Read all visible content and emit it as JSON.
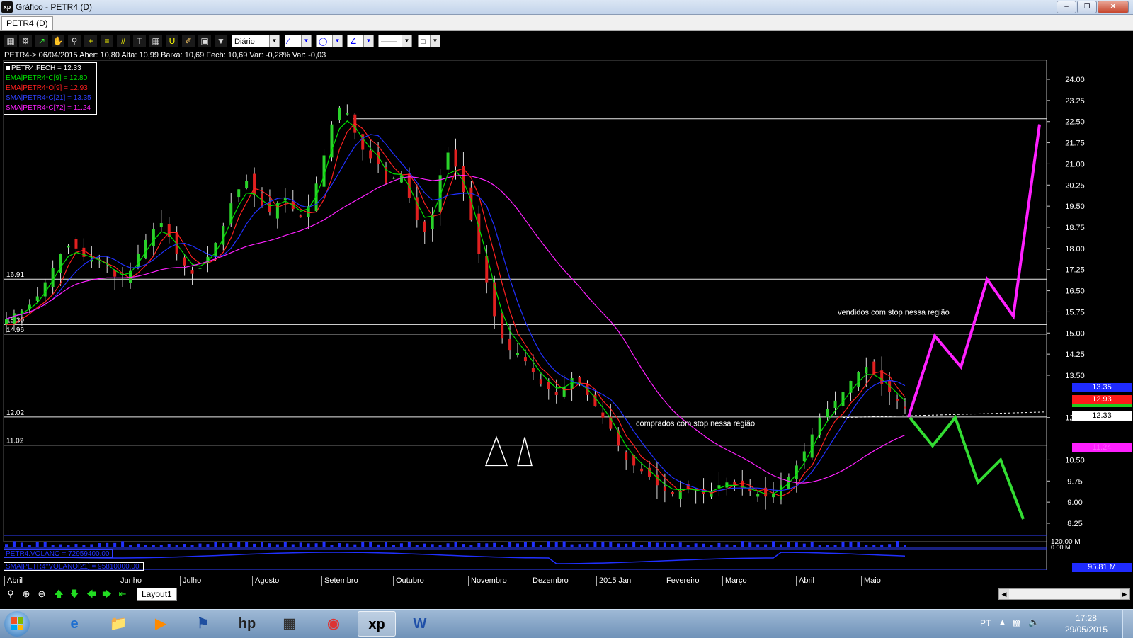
{
  "window": {
    "title": "Gráfico - PETR4 (D)",
    "app_icon": "xp"
  },
  "tabs": [
    {
      "label": "PETR4 (D)"
    }
  ],
  "toolbar": {
    "period_select": "Diário"
  },
  "info_line": "PETR4-> 06/04/2015 Aber: 10,80 Alta: 10,99 Baixa: 10,69 Fech: 10,69 Var: -0,28% Var: -0,03",
  "legend": [
    {
      "label": "PETR4.FECH = 12.33",
      "color": "#ffffff"
    },
    {
      "label": "EMA|PETR4*C[9] = 12.80",
      "color": "#00e000"
    },
    {
      "label": "EMA|PETR4*O[9] = 12.93",
      "color": "#ff2020"
    },
    {
      "label": "SMA|PETR4*C[21] = 13.35",
      "color": "#3040ff"
    },
    {
      "label": "SMA|PETR4*C[72] = 11.24",
      "color": "#ff20ff"
    }
  ],
  "annotations": {
    "sold": "vendidos com stop nessa região",
    "bought": "comprados com stop nessa região"
  },
  "level_labels": [
    "16.91",
    "15.30",
    "14.96",
    "12.02",
    "11.02"
  ],
  "price_tags": [
    {
      "label": "13.35",
      "bg": "#1f2bff",
      "fg": "#ffffff"
    },
    {
      "label": "12.93",
      "bg": "#ff1a1a",
      "fg": "#ffffff"
    },
    {
      "label": "12.33",
      "bg": "#ffffff",
      "fg": "#000000"
    },
    {
      "label": "11.24",
      "bg": "#ff20ff",
      "fg": "#ff20ff"
    },
    {
      "label": "95.81 M",
      "bg": "#1f2bff",
      "fg": "#ffffff"
    }
  ],
  "volume_labels": {
    "vol_axis_top": "120.00 M",
    "vol_axis_zero": "0.00 M",
    "vol_legend": "PETR4.VOLANO = 72959400.00",
    "vol_avg_legend": "SMA|PETR4*VOLANO[21] = 95810000.00"
  },
  "months": [
    "Abril",
    "Junho",
    "Julho",
    "Agosto",
    "Setembro",
    "Outubro",
    "Novembro",
    "Dezembro",
    "2015 Jan",
    "Fevereiro",
    "Março",
    "Abril",
    "Maio"
  ],
  "bottom": {
    "layout_tab": "Layout1"
  },
  "taskbar": {
    "lang": "PT",
    "time": "17:28",
    "date": "29/05/2015"
  },
  "chart_data": {
    "type": "candlestick",
    "y_ticks": [
      "24.00",
      "23.25",
      "22.50",
      "21.75",
      "21.00",
      "20.25",
      "19.50",
      "18.75",
      "18.00",
      "17.25",
      "16.50",
      "15.75",
      "15.00",
      "14.25",
      "13.50",
      "12.00",
      "10.50",
      "9.75",
      "9.00",
      "8.25"
    ],
    "ylim": [
      7.75,
      24.3
    ],
    "horizontal_levels": [
      22.6,
      16.91,
      15.3,
      14.96,
      12.02,
      11.02
    ],
    "series_close": [
      15.5,
      15.7,
      15.8,
      16.0,
      16.3,
      16.8,
      17.3,
      17.8,
      18.1,
      18.0,
      17.7,
      17.6,
      17.5,
      17.3,
      17.0,
      16.9,
      17.2,
      17.8,
      18.3,
      18.7,
      18.9,
      18.4,
      17.8,
      17.4,
      17.1,
      17.3,
      17.7,
      18.2,
      18.8,
      19.6,
      20.1,
      20.4,
      19.9,
      19.5,
      19.3,
      19.6,
      19.8,
      19.4,
      19.1,
      19.5,
      20.3,
      21.3,
      22.4,
      23.0,
      22.8,
      22.1,
      21.5,
      21.2,
      21.0,
      20.3,
      20.5,
      20.6,
      19.8,
      19.0,
      18.6,
      19.2,
      20.6,
      21.4,
      20.9,
      20.0,
      19.0,
      17.8,
      16.8,
      15.6,
      14.8,
      14.4,
      14.3,
      14.0,
      13.6,
      13.2,
      13.0,
      12.8,
      13.1,
      13.4,
      13.2,
      12.8,
      12.4,
      12.0,
      11.6,
      11.0,
      10.5,
      10.3,
      10.1,
      9.9,
      9.6,
      9.4,
      9.3,
      9.4,
      9.5,
      9.4,
      9.3,
      9.4,
      9.6,
      9.7,
      9.6,
      9.5,
      9.4,
      9.3,
      9.2,
      9.3,
      9.6,
      9.9,
      10.3,
      10.8,
      11.4,
      12.0,
      12.3,
      12.6,
      12.9,
      13.3,
      13.6,
      13.8,
      13.5,
      13.2,
      12.9,
      12.6,
      12.33
    ],
    "forecast_up": [
      [
        12.02,
        0
      ],
      [
        14.9,
        1
      ],
      [
        13.8,
        2
      ],
      [
        16.9,
        3
      ],
      [
        15.6,
        4
      ],
      [
        22.4,
        5
      ]
    ],
    "forecast_down": [
      [
        12.0,
        0
      ],
      [
        11.0,
        1
      ],
      [
        12.0,
        2
      ],
      [
        9.7,
        3
      ],
      [
        10.5,
        4
      ],
      [
        8.4,
        5
      ]
    ]
  }
}
